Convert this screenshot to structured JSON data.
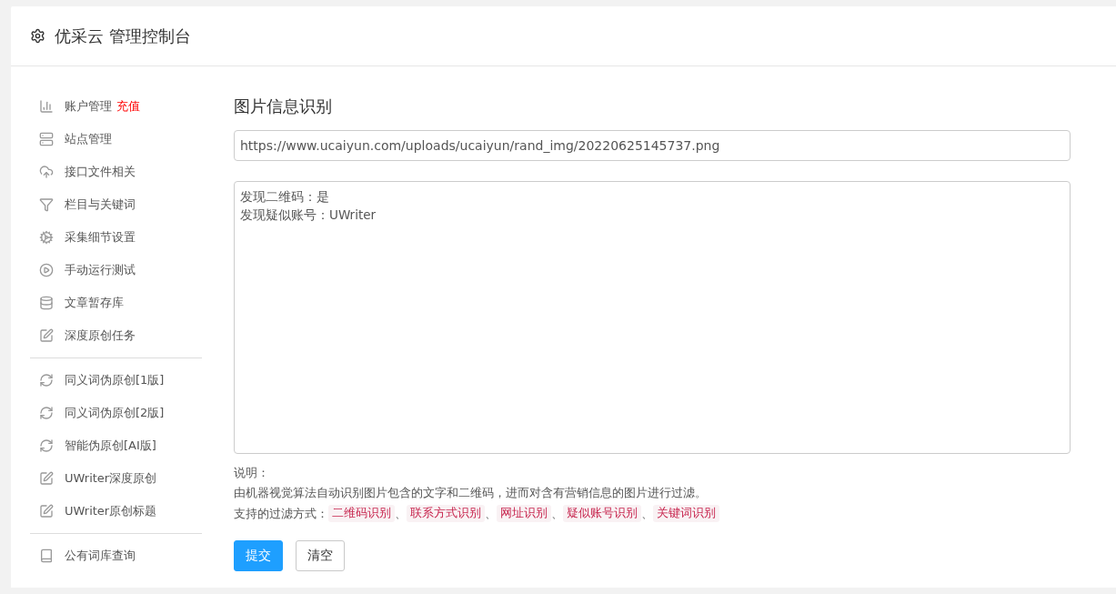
{
  "header": {
    "title": "优采云 管理控制台"
  },
  "sidebar": {
    "groups": [
      {
        "items": [
          {
            "label": "账户管理",
            "badge": "充值"
          },
          {
            "label": "站点管理"
          },
          {
            "label": "接口文件相关"
          },
          {
            "label": "栏目与关键词"
          },
          {
            "label": "采集细节设置"
          },
          {
            "label": "手动运行测试"
          },
          {
            "label": "文章暂存库"
          },
          {
            "label": "深度原创任务"
          }
        ]
      },
      {
        "items": [
          {
            "label": "同义词伪原创[1版]"
          },
          {
            "label": "同义词伪原创[2版]"
          },
          {
            "label": "智能伪原创[AI版]"
          },
          {
            "label": "UWriter深度原创"
          },
          {
            "label": "UWriter原创标题"
          }
        ]
      },
      {
        "items": [
          {
            "label": "公有词库查询"
          }
        ]
      }
    ]
  },
  "main": {
    "title": "图片信息识别",
    "url_field": {
      "value": "https://www.ucaiyun.com/uploads/ucaiyun/rand_img/20220625145737.png"
    },
    "result_lines": [
      "发现二维码：是",
      "发现疑似账号：UWriter"
    ],
    "notes": {
      "heading": "说明：",
      "description": "由机器视觉算法自动识别图片包含的文字和二维码，进而对含有营销信息的图片进行过滤。",
      "methods_label": "支持的过滤方式：",
      "separator": "、",
      "methods": [
        "二维码识别",
        "联系方式识别",
        "网址识别",
        "疑似账号识别",
        "关键词识别"
      ]
    },
    "buttons": [
      {
        "label": "提交",
        "kind": "primary"
      },
      {
        "label": "清空",
        "kind": "default"
      }
    ]
  }
}
